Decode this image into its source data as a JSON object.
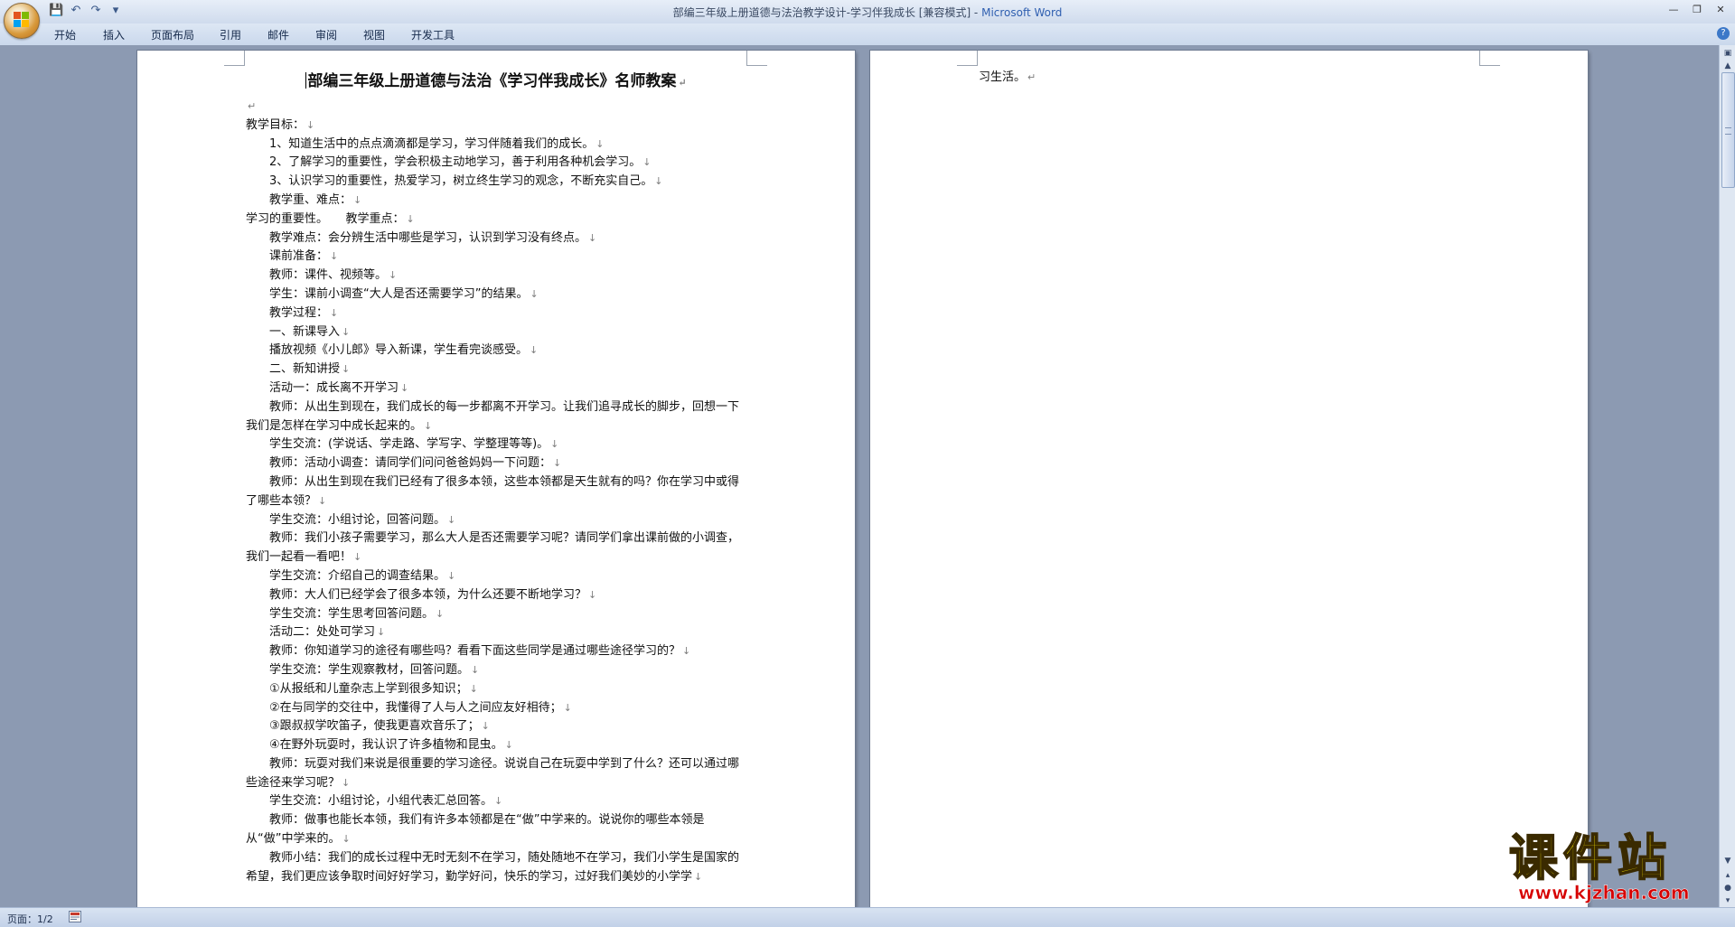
{
  "window": {
    "title": "部编三年级上册道德与法治教学设计-学习伴我成长 [兼容模式] - ",
    "app_name": "Microsoft Word",
    "quick_access": {
      "save": "💾",
      "undo": "↶",
      "redo": "↷",
      "customize": "▾"
    },
    "controls": {
      "minimize": "—",
      "restore": "❐",
      "close": "✕"
    }
  },
  "ribbon": {
    "tabs": [
      "开始",
      "插入",
      "页面布局",
      "引用",
      "邮件",
      "审阅",
      "视图",
      "开发工具"
    ],
    "help": "?"
  },
  "document": {
    "title": "部编三年级上册道德与法治《学习伴我成长》名师教案",
    "lines": [
      {
        "text": "",
        "indent": false
      },
      {
        "text": "教学目标：",
        "indent": false
      },
      {
        "text": "1、知道生活中的点点滴滴都是学习，学习伴随着我们的成长。",
        "indent": true
      },
      {
        "text": "2、了解学习的重要性，学会积极主动地学习，善于利用各种机会学习。",
        "indent": true
      },
      {
        "text": "3、认识学习的重要性，热爱学习，树立终生学习的观念，不断充实自己。",
        "indent": true
      },
      {
        "text": "教学重、难点：",
        "indent": true
      },
      {
        "text": "学习的重要性。　　教学重点：",
        "indent": false
      },
      {
        "text": "教学难点：会分辨生活中哪些是学习，认识到学习没有终点。",
        "indent": true
      },
      {
        "text": "课前准备：",
        "indent": true
      },
      {
        "text": "教师：课件、视频等。",
        "indent": true
      },
      {
        "text": "学生：课前小调查“大人是否还需要学习”的结果。",
        "indent": true
      },
      {
        "text": "教学过程：",
        "indent": true
      },
      {
        "text": "一、新课导入",
        "indent": true
      },
      {
        "text": "播放视频《小儿郎》导入新课，学生看完谈感受。",
        "indent": true
      },
      {
        "text": "二、新知讲授",
        "indent": true
      },
      {
        "text": "活动一：成长离不开学习",
        "indent": true
      },
      {
        "text": "教师：从出生到现在，我们成长的每一步都离不开学习。让我们追寻成长的脚步，回想一下我们是怎样在学习中成长起来的。",
        "indent": true
      },
      {
        "text": "学生交流：(学说话、学走路、学写字、学整理等等)。",
        "indent": true
      },
      {
        "text": "教师：活动小调查：请同学们问问爸爸妈妈一下问题：",
        "indent": true
      },
      {
        "text": "教师：从出生到现在我们已经有了很多本领，这些本领都是天生就有的吗？你在学习中或得了哪些本领？",
        "indent": true
      },
      {
        "text": "学生交流：小组讨论，回答问题。",
        "indent": true
      },
      {
        "text": "教师：我们小孩子需要学习，那么大人是否还需要学习呢？请同学们拿出课前做的小调查，我们一起看一看吧！",
        "indent": true
      },
      {
        "text": "学生交流：介绍自己的调查结果。",
        "indent": true
      },
      {
        "text": "教师：大人们已经学会了很多本领，为什么还要不断地学习？",
        "indent": true
      },
      {
        "text": "学生交流：学生思考回答问题。",
        "indent": true
      },
      {
        "text": "活动二：处处可学习",
        "indent": true
      },
      {
        "text": "教师：你知道学习的途径有哪些吗？看看下面这些同学是通过哪些途径学习的？",
        "indent": true
      },
      {
        "text": "学生交流：学生观察教材，回答问题。",
        "indent": true
      },
      {
        "text": "①从报纸和儿童杂志上学到很多知识；",
        "indent": true
      },
      {
        "text": "②在与同学的交往中，我懂得了人与人之间应友好相待；",
        "indent": true
      },
      {
        "text": "③跟叔叔学吹笛子，使我更喜欢音乐了；",
        "indent": true
      },
      {
        "text": "④在野外玩耍时，我认识了许多植物和昆虫。",
        "indent": true
      },
      {
        "text": "教师：玩耍对我们来说是很重要的学习途径。说说自己在玩耍中学到了什么？还可以通过哪些途径来学习呢？",
        "indent": true
      },
      {
        "text": "学生交流：小组讨论，小组代表汇总回答。",
        "indent": true
      },
      {
        "text": "教师：做事也能长本领，我们有许多本领都是在“做”中学来的。说说你的哪些本领是从“做”中学来的。",
        "indent": true
      },
      {
        "text": "教师小结：我们的成长过程中无时无刻不在学习，随处随地不在学习，我们小学生是国家的希望，我们更应该争取时间好好学习，勤学好问，快乐的学习，过好我们美妙的小学学",
        "indent": true
      }
    ],
    "page2_text": "习生活。",
    "line_mark": "↓",
    "para_mark": "↵"
  },
  "statusbar": {
    "page_info": "页面：1/2"
  },
  "watermark": {
    "text": "课件站",
    "url": "www.kjzhan.com"
  }
}
